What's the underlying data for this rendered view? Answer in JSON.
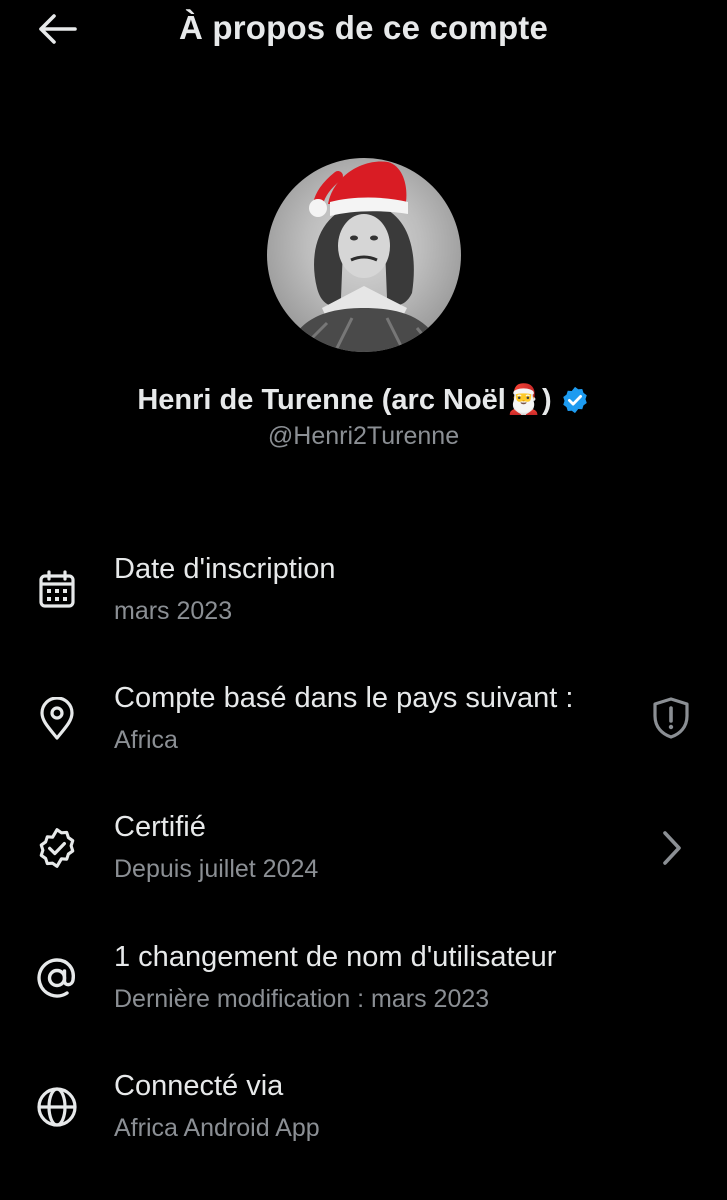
{
  "header": {
    "back_icon": "arrow-left-icon",
    "title": "À propos de ce compte"
  },
  "profile": {
    "display_name": "Henri de Turenne (arc Noël🎅)",
    "verified_icon": "verified-badge-icon",
    "handle": "@Henri2Turenne"
  },
  "colors": {
    "background": "#000000",
    "primary_text": "#e7e9ea",
    "secondary_text": "#8b8f94",
    "verified_blue": "#1d9bf0"
  },
  "rows": [
    {
      "icon": "calendar-icon",
      "title": "Date d'inscription",
      "subtitle": "mars 2023"
    },
    {
      "icon": "location-pin-icon",
      "title": "Compte basé dans le pays suivant :",
      "subtitle": "Africa",
      "trailing_icon": "shield-alert-icon"
    },
    {
      "icon": "verified-check-icon",
      "title": "Certifié",
      "subtitle": "Depuis juillet 2024",
      "trailing_icon": "chevron-right-icon"
    },
    {
      "icon": "at-sign-icon",
      "title": "1 changement de nom d'utilisateur",
      "subtitle": "Dernière modification : mars 2023"
    },
    {
      "icon": "globe-icon",
      "title": "Connecté via",
      "subtitle": "Africa Android App"
    }
  ]
}
